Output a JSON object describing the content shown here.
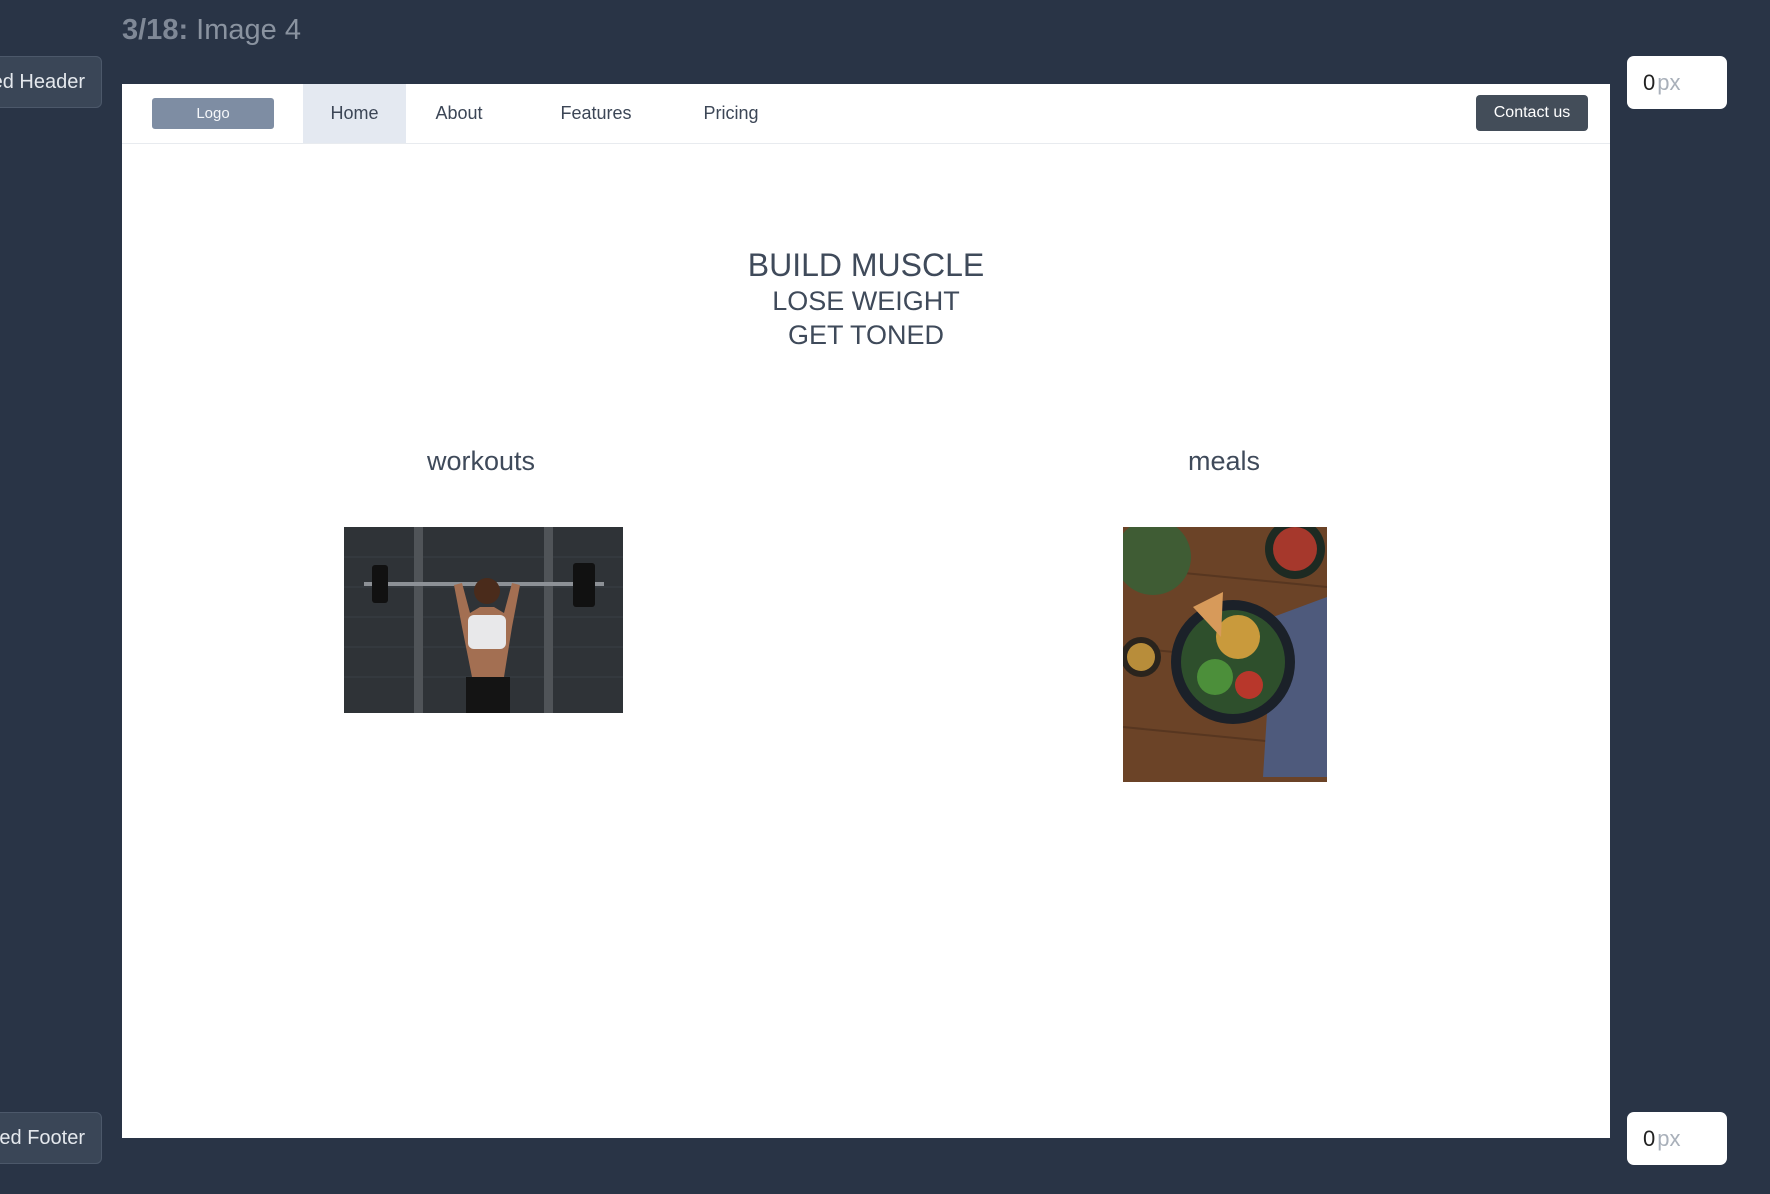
{
  "editor": {
    "step_count": "3/18:",
    "step_title": "Image 4",
    "header_tab": "Fixed Header",
    "footer_tab": "Fixed Footer",
    "top_offset": "0",
    "bottom_offset": "0",
    "unit": "px"
  },
  "nav": {
    "logo": "Logo",
    "items": [
      "Home",
      "About",
      "Features",
      "Pricing"
    ],
    "active": "Home",
    "contact": "Contact us"
  },
  "hero": {
    "line1": "BUILD MUSCLE",
    "line2": "LOSE WEIGHT",
    "line3": "GET TONED"
  },
  "columns": {
    "left_label": "workouts",
    "right_label": "meals"
  },
  "colors": {
    "editor_bg": "#293446",
    "nav_active_bg": "#e4e9f1",
    "logo_bg": "#7e8da3",
    "contact_bg": "#434d59",
    "text": "#3f4a5a"
  }
}
